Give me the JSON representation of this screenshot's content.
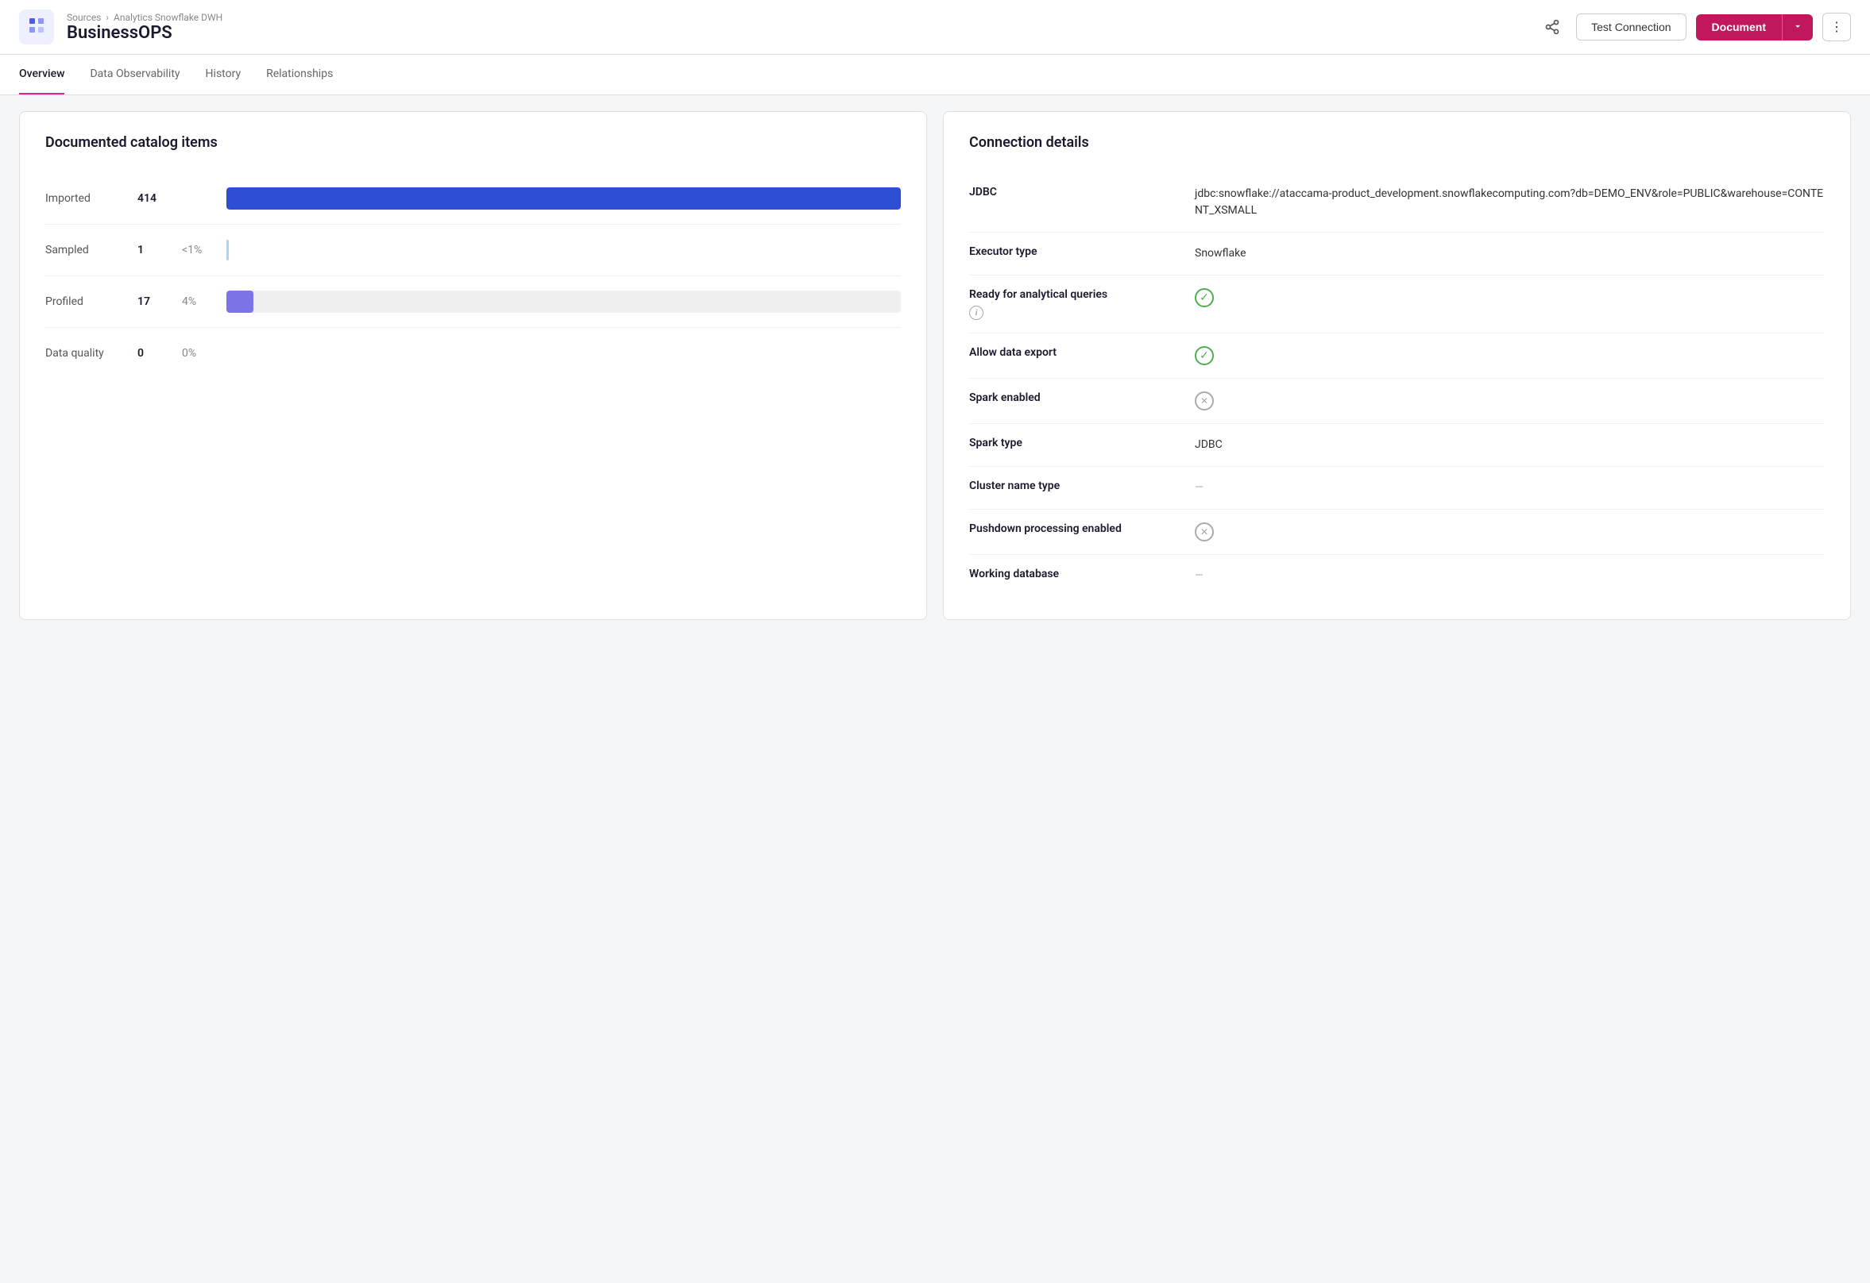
{
  "header": {
    "logo_icon": "⊞",
    "breadcrumb_parent": "Sources",
    "breadcrumb_separator": "›",
    "breadcrumb_current": "Analytics Snowflake DWH",
    "page_title": "BusinessOPS",
    "share_label": "share",
    "btn_test": "Test Connection",
    "btn_document": "Document",
    "btn_more": "⋮"
  },
  "tabs": [
    {
      "id": "overview",
      "label": "Overview",
      "active": true
    },
    {
      "id": "data-observability",
      "label": "Data Observability",
      "active": false
    },
    {
      "id": "history",
      "label": "History",
      "active": false
    },
    {
      "id": "relationships",
      "label": "Relationships",
      "active": false
    }
  ],
  "catalog": {
    "title": "Documented catalog items",
    "rows": [
      {
        "label": "Imported",
        "num": "414",
        "pct": "",
        "bar_type": "full"
      },
      {
        "label": "Sampled",
        "num": "1",
        "pct": "<1%",
        "bar_type": "dot"
      },
      {
        "label": "Profiled",
        "num": "17",
        "pct": "4%",
        "bar_type": "partial"
      },
      {
        "label": "Data quality",
        "num": "0",
        "pct": "0%",
        "bar_type": "none"
      }
    ]
  },
  "connection": {
    "title": "Connection details",
    "rows": [
      {
        "label": "JDBC",
        "sub_label": "",
        "value": "jdbc:snowflake://ataccama-product_development.snowflakecomputing.com?db=DEMO_ENV&role=PUBLIC&warehouse=CONTENT_XSMALL",
        "value_type": "text"
      },
      {
        "label": "Executor type",
        "sub_label": "",
        "value": "Snowflake",
        "value_type": "text"
      },
      {
        "label": "Ready for analytical queries",
        "sub_label": "info",
        "value": "check",
        "value_type": "check_green"
      },
      {
        "label": "Allow data export",
        "sub_label": "",
        "value": "check",
        "value_type": "check_green"
      },
      {
        "label": "Spark enabled",
        "sub_label": "",
        "value": "cross",
        "value_type": "cross_gray"
      },
      {
        "label": "Spark type",
        "sub_label": "",
        "value": "JDBC",
        "value_type": "text"
      },
      {
        "label": "Cluster name type",
        "sub_label": "",
        "value": "—",
        "value_type": "dash"
      },
      {
        "label": "Pushdown processing enabled",
        "sub_label": "",
        "value": "cross",
        "value_type": "cross_gray"
      },
      {
        "label": "Working database",
        "sub_label": "",
        "value": "—",
        "value_type": "dash"
      }
    ]
  }
}
